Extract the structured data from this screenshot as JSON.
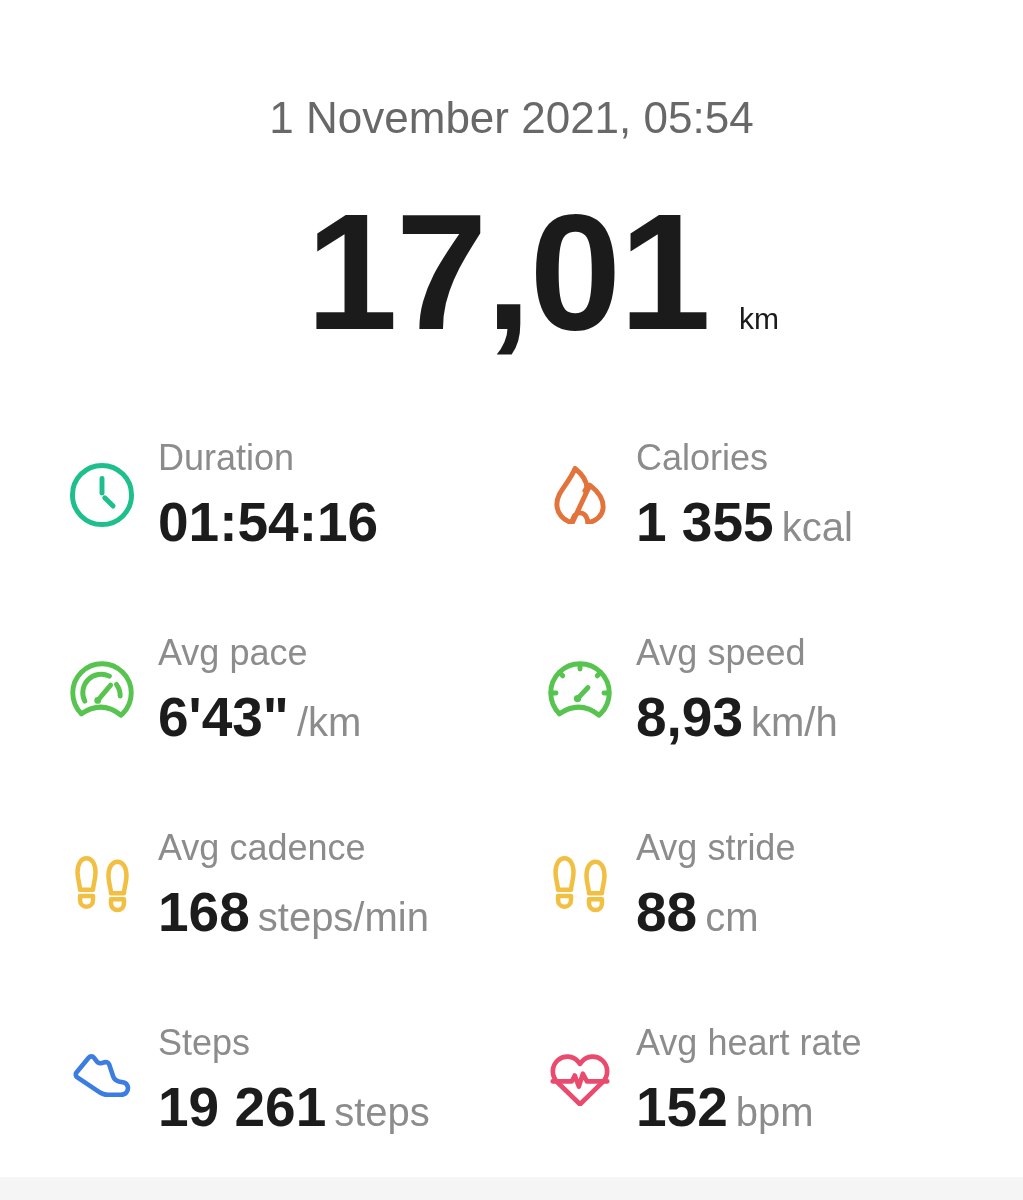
{
  "activity": {
    "date": "1 November 2021, 05:54",
    "distance": {
      "value": "17,01",
      "unit": "km"
    }
  },
  "stats": [
    {
      "kind": "clock",
      "label": "Duration",
      "value": "01:54:16"
    },
    {
      "kind": "flame",
      "label": "Calories",
      "value": "1 355",
      "unit": "kcal"
    },
    {
      "kind": "pace",
      "label": "Avg pace",
      "value": "6'43\"",
      "unit": "/km"
    },
    {
      "kind": "speed",
      "label": "Avg speed",
      "value": "8,93",
      "unit": "km/h"
    },
    {
      "kind": "footprints",
      "label": "Avg cadence",
      "value": "168",
      "unit": "steps/min"
    },
    {
      "kind": "footprints",
      "label": "Avg stride",
      "value": "88",
      "unit": "cm"
    },
    {
      "kind": "shoe",
      "label": "Steps",
      "value": "19 261",
      "unit": "steps"
    },
    {
      "kind": "heart",
      "label": "Avg heart rate",
      "value": "152",
      "unit": "bpm"
    }
  ]
}
